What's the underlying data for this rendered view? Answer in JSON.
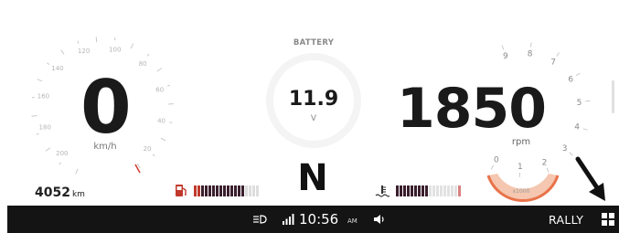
{
  "speedometer": {
    "scale_labels": [
      "20",
      "40",
      "60",
      "80",
      "100",
      "120",
      "140",
      "160",
      "180",
      "200"
    ],
    "value": "0",
    "unit": "km/h"
  },
  "odometer": {
    "value": "4052",
    "unit": "km"
  },
  "fuel": {
    "icon": "fuel-pump-icon",
    "level_fraction": 0.75
  },
  "battery": {
    "title": "BATTERY",
    "value": "11.9",
    "unit": "V"
  },
  "gear": {
    "value": "N"
  },
  "coolant": {
    "icon": "coolant-temperature-icon",
    "level_fraction": 0.5
  },
  "tachometer": {
    "value": "1850",
    "unit": "rpm",
    "multiplier": "x1000",
    "scale_labels": [
      "0",
      "1",
      "2",
      "3",
      "4",
      "5",
      "6",
      "7",
      "8",
      "9"
    ],
    "active_color": "#e8734a",
    "active_fill": "#f6c7b0"
  },
  "status_bar": {
    "time": "10:56",
    "ampm": "AM",
    "mode": "RALLY",
    "icons": [
      "headlight-icon",
      "signal-strength-icon",
      "volume-icon",
      "grid-menu-icon"
    ]
  },
  "colors": {
    "status_bar_bg": "#141414",
    "fuel_red": "#c0392b",
    "temp_red": "#d98080",
    "segment_dark": "#3a1f2e"
  }
}
